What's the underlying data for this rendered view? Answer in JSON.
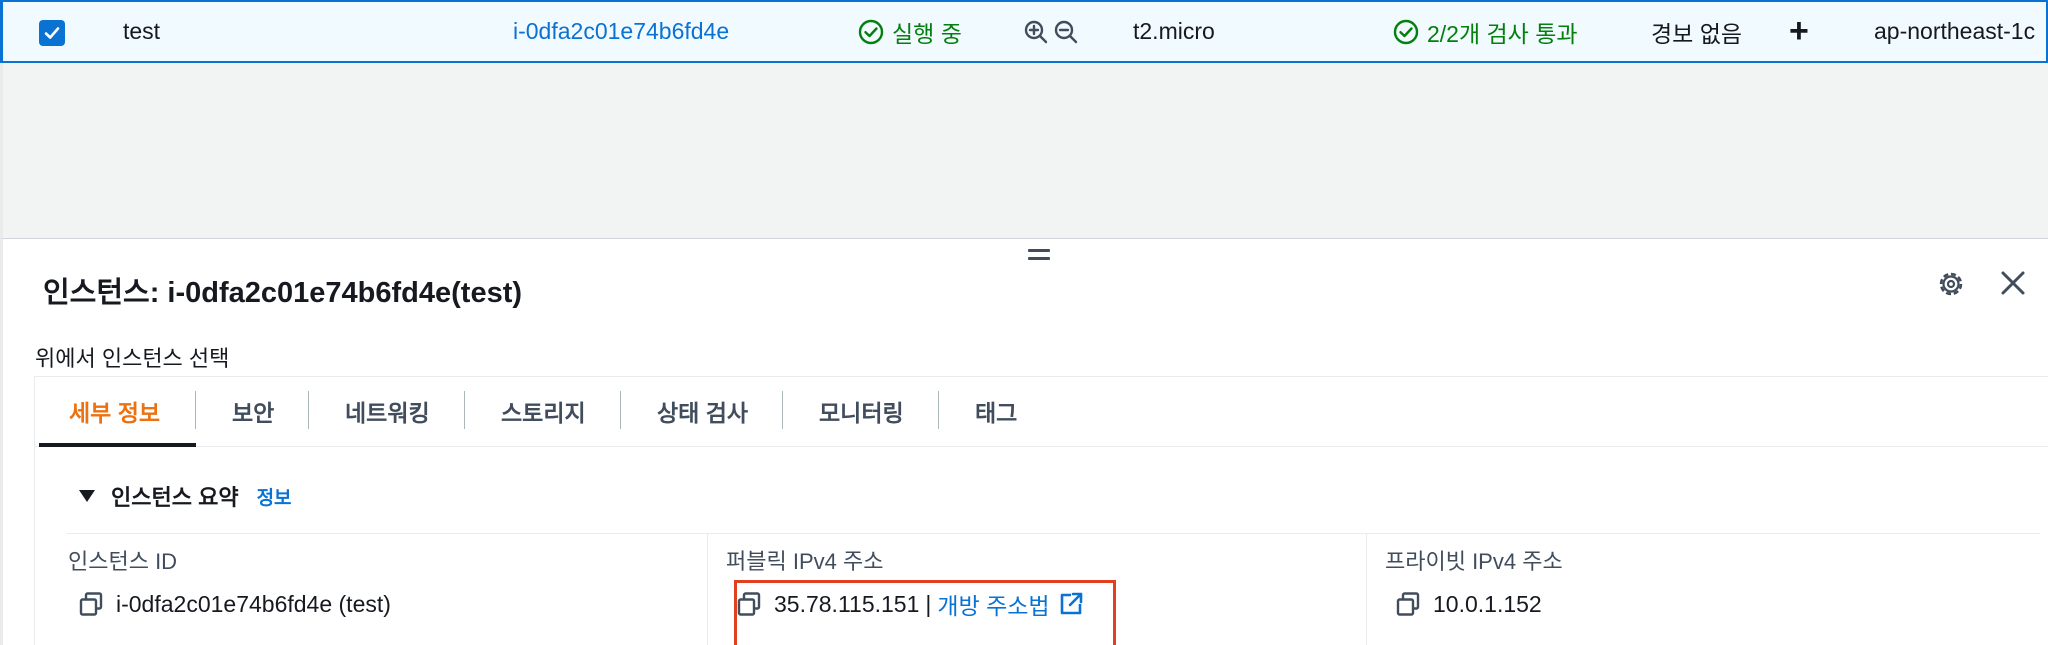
{
  "instance_row": {
    "selected": true,
    "name": "test",
    "instance_id": "i-0dfa2c01e74b6fd4e",
    "state": "실행 중",
    "instance_type": "t2.micro",
    "status_check": "2/2개 검사 통과",
    "alarm_status": "경보 없음",
    "add_alarm_symbol": "+",
    "availability_zone": "ap-northeast-1c",
    "state_color": "#037f0c",
    "link_color": "#0972d3"
  },
  "detail_panel": {
    "title": "인스턴스: i-0dfa2c01e74b6fd4e(test)",
    "subtitle": "위에서 인스턴스 선택",
    "tabs": [
      "세부 정보",
      "보안",
      "네트워킹",
      "스토리지",
      "상태 검사",
      "모니터링",
      "태그"
    ],
    "active_tab": "세부 정보",
    "active_tab_color": "#ec7211",
    "section": {
      "title": "인스턴스 요약",
      "info_link": "정보"
    },
    "fields": [
      {
        "label": "인스턴스 ID",
        "value": "i-0dfa2c01e74b6fd4e (test)"
      },
      {
        "label": "퍼블릭 IPv4 주소",
        "value": "35.78.115.151",
        "separator": "|",
        "link": "개방 주소법"
      },
      {
        "label": "프라이빗 IPv4 주소",
        "value": "10.0.1.152"
      }
    ],
    "highlight_color": "#e0401f"
  }
}
